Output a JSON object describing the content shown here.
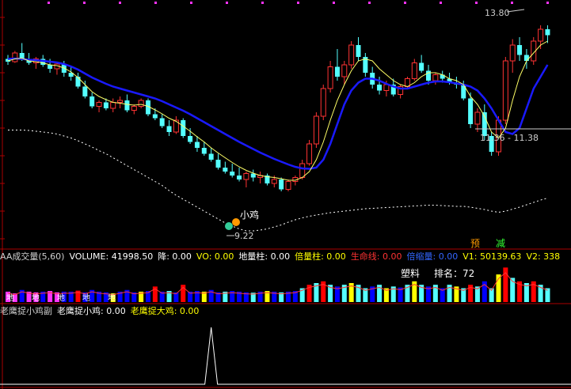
{
  "colors": {
    "up": "#ff3333",
    "down": "#54ffff",
    "ma": "#ffff66",
    "life_line": "#1a1aff",
    "dotted": "#ffffff",
    "axis": "#aa0000",
    "vol_yellow": "#ffff00",
    "vol_blue": "#0000ff",
    "vol_red": "#ff0000",
    "vol_cyan": "#54ffff",
    "vol_magenta": "#ff33ff"
  },
  "main_panel": {
    "high_label": "13.80",
    "range_label": "11.36 - 11.38",
    "low_label": "9.22",
    "signal_label": "小鸡",
    "yu_label": "预",
    "jian_label": "减"
  },
  "volume_panel": {
    "indicator_name": "AA成交量(5,60)",
    "volume": "VOLUME: 41998.50",
    "jiang": "降: 0.00",
    "vo": "VO: 0.00",
    "di_liang_zhu": "地量柱: 0.00",
    "bei_liang_zhu": "倍量柱: 0.00",
    "sheng_ming_xian": "生命线: 0.00",
    "bei_suo_liang": "倍缩量: 0.00",
    "v1": "V1: 50139.63",
    "v2": "V2: 338",
    "sector": "塑料",
    "rank": "排名：72",
    "left_marks": [
      "地",
      "地",
      "地",
      "地",
      "地"
    ]
  },
  "sub_panel": {
    "indicator_name": "老鹰捉小鸡副",
    "small_chicken": "老鹰捉小鸡: 0.00",
    "big_chicken": "老鹰捉大鸡: 0.00"
  },
  "chart_data": [
    {
      "type": "candlestick",
      "title": "",
      "ohlc": [
        [
          12.95,
          13.05,
          12.8,
          12.88
        ],
        [
          12.88,
          13.15,
          12.85,
          13.1
        ],
        [
          13.1,
          13.35,
          12.9,
          12.95
        ],
        [
          12.95,
          13.1,
          12.8,
          12.85
        ],
        [
          12.85,
          13.0,
          12.7,
          12.95
        ],
        [
          12.95,
          13.05,
          12.75,
          12.8
        ],
        [
          12.8,
          12.95,
          12.6,
          12.7
        ],
        [
          12.7,
          12.85,
          12.55,
          12.82
        ],
        [
          12.82,
          12.9,
          12.5,
          12.6
        ],
        [
          12.6,
          12.75,
          12.4,
          12.5
        ],
        [
          12.5,
          12.6,
          12.2,
          12.25
        ],
        [
          12.25,
          12.4,
          11.95,
          12.0
        ],
        [
          12.0,
          12.1,
          11.7,
          11.75
        ],
        [
          11.75,
          11.9,
          11.6,
          11.85
        ],
        [
          11.85,
          11.95,
          11.65,
          11.7
        ],
        [
          11.7,
          11.95,
          11.6,
          11.85
        ],
        [
          11.85,
          12.0,
          11.7,
          11.9
        ],
        [
          11.9,
          12.05,
          11.6,
          11.65
        ],
        [
          11.65,
          11.8,
          11.55,
          11.75
        ],
        [
          11.75,
          11.95,
          11.7,
          11.9
        ],
        [
          11.9,
          11.95,
          11.5,
          11.55
        ],
        [
          11.55,
          11.7,
          11.4,
          11.45
        ],
        [
          11.45,
          11.55,
          11.2,
          11.25
        ],
        [
          11.25,
          11.4,
          11.0,
          11.1
        ],
        [
          11.1,
          11.5,
          11.05,
          11.4
        ],
        [
          11.4,
          11.45,
          10.95,
          11.0
        ],
        [
          11.0,
          11.2,
          10.8,
          10.85
        ],
        [
          10.85,
          11.0,
          10.6,
          10.7
        ],
        [
          10.7,
          10.85,
          10.5,
          10.55
        ],
        [
          10.55,
          10.7,
          10.35,
          10.4
        ],
        [
          10.4,
          10.55,
          10.15,
          10.2
        ],
        [
          10.2,
          10.35,
          10.05,
          10.1
        ],
        [
          10.1,
          10.3,
          9.95,
          10.0
        ],
        [
          10.0,
          10.2,
          9.85,
          9.9
        ],
        [
          9.9,
          10.1,
          9.7,
          10.05
        ],
        [
          10.05,
          10.15,
          9.85,
          9.95
        ],
        [
          9.95,
          10.1,
          9.8,
          10.0
        ],
        [
          10.0,
          10.05,
          9.75,
          9.8
        ],
        [
          9.8,
          10.0,
          9.7,
          9.9
        ],
        [
          9.9,
          9.95,
          9.6,
          9.65
        ],
        [
          9.65,
          9.9,
          9.6,
          9.85
        ],
        [
          9.85,
          10.0,
          9.75,
          9.95
        ],
        [
          9.95,
          10.4,
          9.9,
          10.3
        ],
        [
          10.3,
          10.9,
          10.25,
          10.8
        ],
        [
          10.8,
          11.6,
          10.7,
          11.5
        ],
        [
          11.5,
          12.3,
          11.4,
          12.2
        ],
        [
          12.2,
          12.9,
          12.1,
          12.75
        ],
        [
          12.75,
          13.2,
          12.4,
          12.5
        ],
        [
          12.5,
          12.9,
          12.3,
          12.8
        ],
        [
          12.8,
          13.4,
          12.7,
          13.3
        ],
        [
          13.3,
          13.5,
          12.9,
          13.0
        ],
        [
          13.0,
          13.1,
          12.5,
          12.6
        ],
        [
          12.6,
          12.75,
          12.2,
          12.3
        ],
        [
          12.3,
          12.5,
          12.05,
          12.15
        ],
        [
          12.15,
          12.4,
          12.0,
          12.3
        ],
        [
          12.3,
          12.45,
          12.0,
          12.05
        ],
        [
          12.05,
          12.3,
          11.95,
          12.25
        ],
        [
          12.25,
          12.5,
          12.2,
          12.45
        ],
        [
          12.45,
          12.95,
          12.4,
          12.85
        ],
        [
          12.85,
          13.05,
          12.6,
          12.65
        ],
        [
          12.65,
          12.8,
          12.3,
          12.4
        ],
        [
          12.4,
          12.6,
          12.3,
          12.55
        ],
        [
          12.55,
          12.65,
          12.35,
          12.45
        ],
        [
          12.45,
          12.6,
          12.3,
          12.35
        ],
        [
          12.35,
          12.5,
          12.2,
          12.3
        ],
        [
          12.3,
          12.4,
          11.9,
          11.95
        ],
        [
          11.95,
          12.1,
          11.2,
          11.3
        ],
        [
          11.3,
          11.7,
          11.1,
          11.6
        ],
        [
          11.6,
          11.8,
          10.9,
          11.0
        ],
        [
          11.0,
          11.1,
          10.5,
          10.6
        ],
        [
          10.6,
          11.5,
          10.5,
          11.4
        ],
        [
          11.4,
          13.0,
          11.3,
          12.9
        ],
        [
          12.9,
          13.45,
          12.6,
          13.3
        ],
        [
          13.3,
          13.5,
          12.9,
          13.05
        ],
        [
          13.05,
          13.2,
          12.7,
          12.9
        ],
        [
          12.9,
          13.5,
          12.8,
          13.4
        ],
        [
          13.4,
          13.8,
          13.2,
          13.7
        ],
        [
          13.7,
          13.8,
          13.35,
          13.55
        ]
      ],
      "ma_close": [
        12.9,
        12.95,
        12.97,
        12.9,
        12.88,
        12.85,
        12.8,
        12.78,
        12.72,
        12.62,
        12.48,
        12.3,
        12.12,
        12.0,
        11.92,
        11.85,
        11.83,
        11.8,
        11.78,
        11.8,
        11.75,
        11.66,
        11.56,
        11.45,
        11.37,
        11.25,
        11.12,
        10.98,
        10.85,
        10.7,
        10.57,
        10.45,
        10.33,
        10.22,
        10.13,
        10.06,
        10.0,
        9.97,
        9.95,
        9.92,
        9.88,
        9.88,
        9.95,
        10.1,
        10.4,
        10.85,
        11.4,
        11.9,
        12.3,
        12.65,
        12.9,
        12.95,
        12.9,
        12.7,
        12.55,
        12.4,
        12.3,
        12.25,
        12.35,
        12.5,
        12.6,
        12.6,
        12.55,
        12.45,
        12.4,
        12.3,
        12.0,
        11.8,
        11.5,
        11.1,
        10.95,
        11.2,
        11.9,
        12.5,
        12.9,
        13.1,
        13.3,
        13.4
      ],
      "life_line": [
        12.95,
        12.96,
        12.95,
        12.93,
        12.92,
        12.9,
        12.88,
        12.86,
        12.82,
        12.76,
        12.68,
        12.58,
        12.48,
        12.4,
        12.32,
        12.25,
        12.2,
        12.15,
        12.1,
        12.05,
        12.0,
        11.95,
        11.88,
        11.8,
        11.72,
        11.64,
        11.55,
        11.45,
        11.35,
        11.25,
        11.15,
        11.05,
        10.95,
        10.85,
        10.76,
        10.67,
        10.58,
        10.5,
        10.42,
        10.35,
        10.28,
        10.22,
        10.18,
        10.17,
        10.2,
        10.4,
        10.8,
        11.3,
        11.8,
        12.15,
        12.35,
        12.45,
        12.45,
        12.4,
        12.32,
        12.25,
        12.2,
        12.2,
        12.25,
        12.3,
        12.35,
        12.38,
        12.38,
        12.36,
        12.33,
        12.3,
        12.25,
        12.15,
        11.95,
        11.7,
        11.4,
        11.1,
        11.05,
        11.2,
        11.7,
        12.2,
        12.5,
        12.8
      ],
      "dotted_ma": [
        11.15,
        11.15,
        11.15,
        11.14,
        11.12,
        11.1,
        11.08,
        11.05,
        11.0,
        10.95,
        10.88,
        10.8,
        10.72,
        10.63,
        10.55,
        10.45,
        10.35,
        10.25,
        10.15,
        10.05,
        9.95,
        9.85,
        9.75,
        9.62,
        9.5,
        9.4,
        9.3,
        9.2,
        9.1,
        9.0,
        8.9,
        8.8,
        8.72,
        8.65,
        8.6,
        8.6,
        8.62,
        8.65,
        8.7,
        8.75,
        8.82,
        8.88,
        8.93,
        8.97,
        9.0,
        9.03,
        9.06,
        9.08,
        9.1,
        9.12,
        9.14,
        9.16,
        9.17,
        9.18,
        9.19,
        9.2,
        9.21,
        9.22,
        9.23,
        9.24,
        9.25,
        9.25,
        9.24,
        9.23,
        9.22,
        9.22,
        9.2,
        9.17,
        9.14,
        9.1,
        9.07,
        9.1,
        9.15,
        9.2,
        9.26,
        9.32,
        9.38,
        9.43
      ],
      "ylim": [
        8.5,
        14.2
      ]
    },
    {
      "type": "bar",
      "title": "",
      "volumes": [
        0.3,
        0.25,
        0.35,
        0.3,
        0.28,
        0.3,
        0.32,
        0.28,
        0.3,
        0.3,
        0.33,
        0.28,
        0.35,
        0.3,
        0.28,
        0.25,
        0.3,
        0.35,
        0.28,
        0.3,
        0.32,
        0.45,
        0.3,
        0.32,
        0.28,
        0.5,
        0.3,
        0.32,
        0.3,
        0.35,
        0.28,
        0.3,
        0.32,
        0.3,
        0.28,
        0.27,
        0.3,
        0.32,
        0.3,
        0.28,
        0.3,
        0.32,
        0.4,
        0.5,
        0.55,
        0.6,
        0.5,
        0.45,
        0.5,
        0.55,
        0.5,
        0.4,
        0.45,
        0.5,
        0.4,
        0.45,
        0.42,
        0.5,
        0.6,
        0.5,
        0.45,
        0.5,
        0.4,
        0.5,
        0.45,
        0.4,
        0.5,
        0.45,
        0.6,
        0.4,
        0.8,
        1.0,
        0.7,
        0.6,
        0.55,
        0.6,
        0.5,
        0.4
      ],
      "volume_colors": [
        "m",
        "m",
        "b",
        "m",
        "m",
        "b",
        "m",
        "m",
        "b",
        "b",
        "r",
        "b",
        "b",
        "b",
        "b",
        "y",
        "b",
        "b",
        "b",
        "y",
        "b",
        "r",
        "b",
        "c",
        "b",
        "r",
        "b",
        "b",
        "y",
        "b",
        "b",
        "c",
        "b",
        "b",
        "b",
        "c",
        "b",
        "y",
        "b",
        "c",
        "b",
        "b",
        "c",
        "r",
        "c",
        "r",
        "c",
        "b",
        "c",
        "y",
        "c",
        "c",
        "b",
        "c",
        "y",
        "c",
        "b",
        "c",
        "y",
        "c",
        "b",
        "c",
        "b",
        "c",
        "y",
        "c",
        "r",
        "c",
        "b",
        "c",
        "y",
        "r",
        "c",
        "r",
        "c",
        "r",
        "c",
        "c"
      ],
      "ylim": [
        0,
        1.1
      ]
    },
    {
      "type": "line",
      "title": "",
      "spike_index": 29,
      "values_note_visible": "老鹰捉小鸡: 0.00"
    }
  ]
}
